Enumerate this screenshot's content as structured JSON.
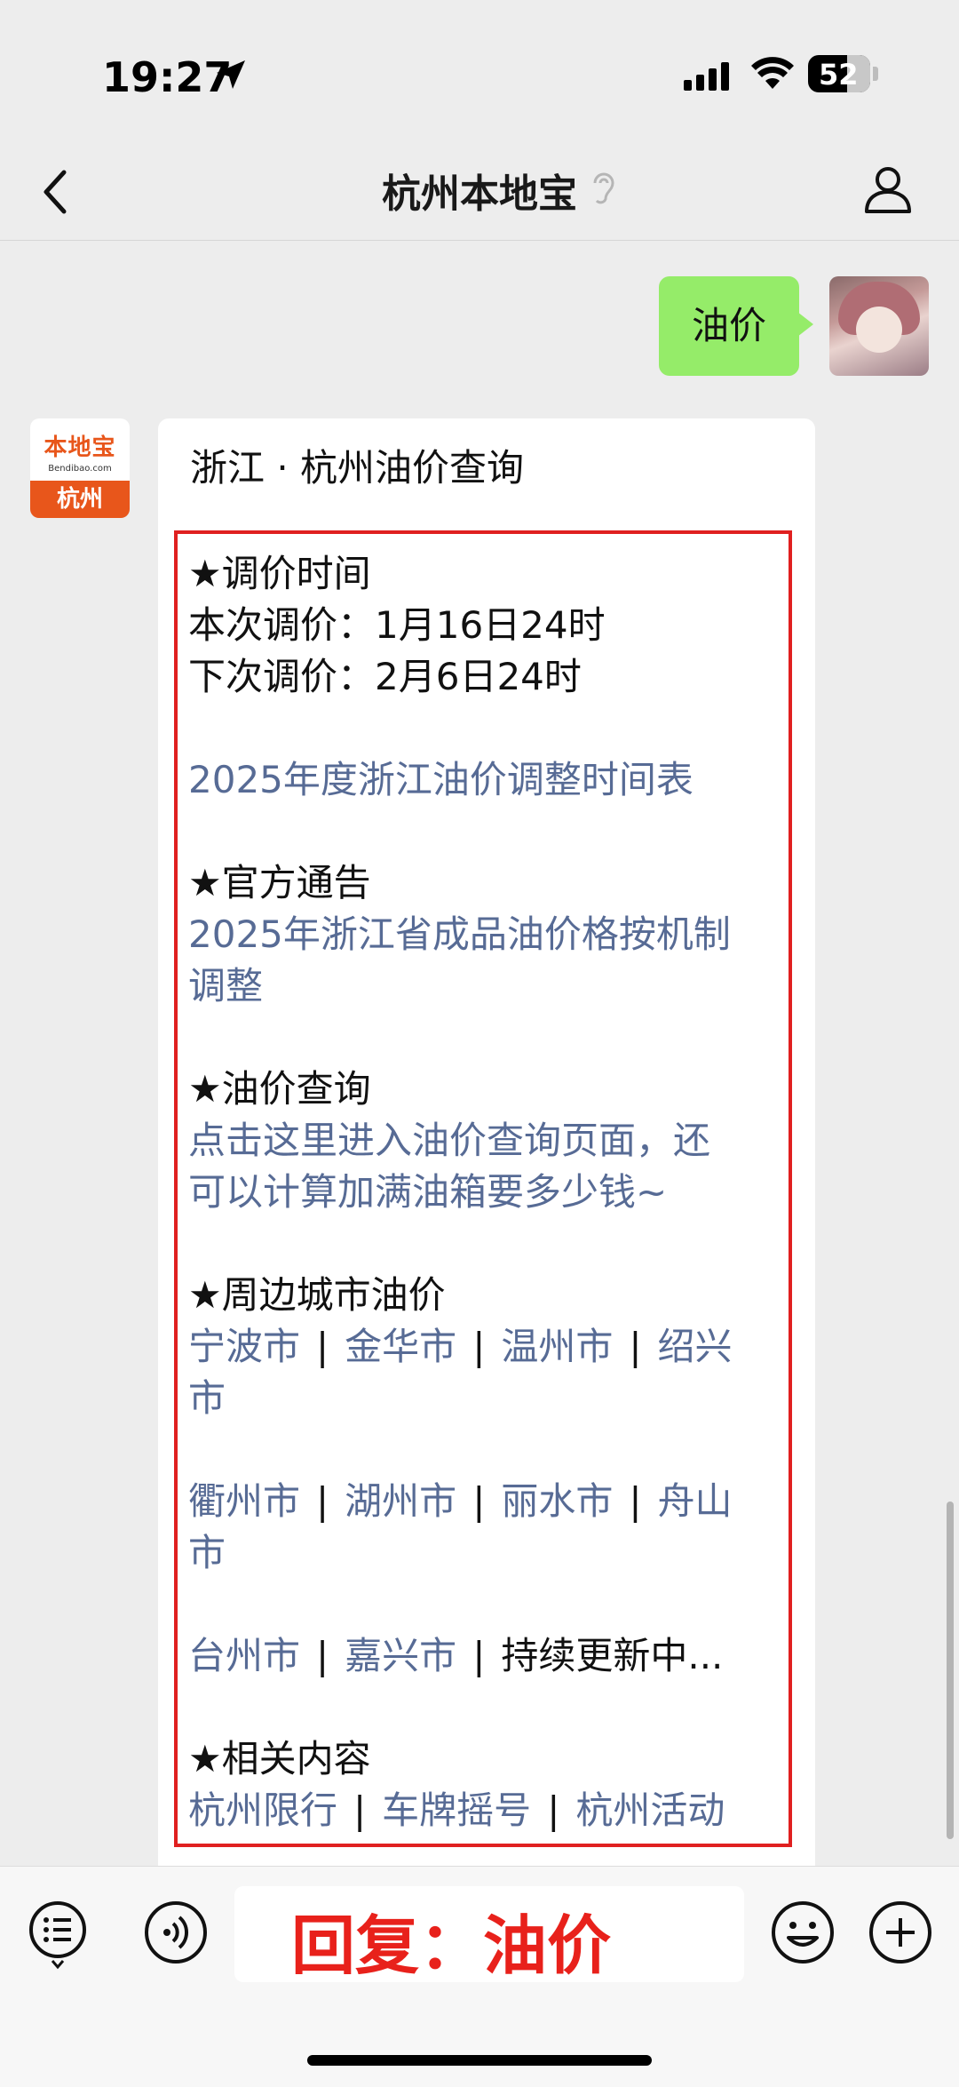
{
  "status_bar": {
    "time": "19:27",
    "battery": "52"
  },
  "nav": {
    "title": "杭州本地宝"
  },
  "messages": {
    "sent": "油价",
    "bot_logo": {
      "main": "本地宝",
      "sub": "Bendibao.com",
      "city": "杭州"
    },
    "card": {
      "title": "浙江 · 杭州油价查询",
      "section1_heading": "★调价时间",
      "current_adjust": "本次调价：1月16日24时",
      "next_adjust": "下次调价：2月6日24时",
      "schedule_link": "2025年度浙江油价调整时间表",
      "section2_heading": "★官方通告",
      "notice_link_line1": "2025年浙江省成品油价格按机制",
      "notice_link_line2": "调整",
      "section3_heading": "★油价查询",
      "query_link_line1": "点击这里进入油价查询页面，还",
      "query_link_line2": "可以计算加满油箱要多少钱~",
      "section4_heading": "★周边城市油价",
      "cities_row1": [
        "宁波市",
        "金华市",
        "温州市",
        "绍兴"
      ],
      "cities_row1_wrap": "市",
      "cities_row2": [
        "衢州市",
        "湖州市",
        "丽水市",
        "舟山"
      ],
      "cities_row2_wrap": "市",
      "cities_row3": [
        "台州市",
        "嘉兴市"
      ],
      "updating": "持续更新中...",
      "section5_heading": "★相关内容",
      "related": [
        "杭州限行",
        "车牌摇号",
        "杭州活动"
      ],
      "separator": "|"
    }
  },
  "input_bar": {
    "text": "回复：油价"
  }
}
